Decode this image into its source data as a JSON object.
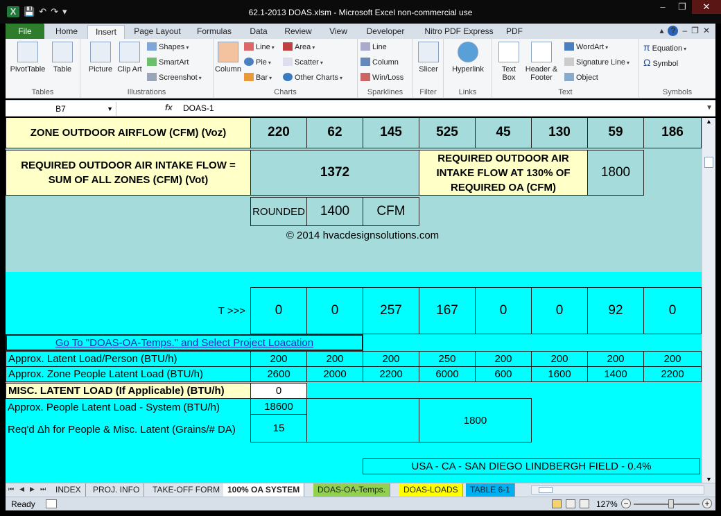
{
  "window": {
    "title": "62.1-2013 DOAS.xlsm  -  Microsoft Excel non-commercial use",
    "app_icon": "X",
    "save_icon": "save-icon",
    "undo_icon": "undo-icon",
    "redo_icon": "redo-icon"
  },
  "ribbon_tabs": [
    {
      "label": "File"
    },
    {
      "label": "Home"
    },
    {
      "label": "Insert"
    },
    {
      "label": "Page Layout"
    },
    {
      "label": "Formulas"
    },
    {
      "label": "Data"
    },
    {
      "label": "Review"
    },
    {
      "label": "View"
    },
    {
      "label": "Developer"
    },
    {
      "label": "Nitro PDF Express"
    },
    {
      "label": "PDF"
    }
  ],
  "active_tab": "Insert",
  "ribbon": {
    "tables": {
      "label": "Tables",
      "pivot": "PivotTable",
      "table": "Table"
    },
    "illustrations": {
      "label": "Illustrations",
      "picture": "Picture",
      "clipart": "Clip Art",
      "shapes": "Shapes",
      "smartart": "SmartArt",
      "screenshot": "Screenshot"
    },
    "charts": {
      "label": "Charts",
      "column": "Column",
      "line": "Line",
      "pie": "Pie",
      "bar": "Bar",
      "area": "Area",
      "scatter": "Scatter",
      "other": "Other Charts"
    },
    "sparklines": {
      "label": "Sparklines",
      "line": "Line",
      "column": "Column",
      "winloss": "Win/Loss"
    },
    "filter": {
      "label": "Filter",
      "slicer": "Slicer"
    },
    "links": {
      "label": "Links",
      "hyperlink": "Hyperlink"
    },
    "text": {
      "label": "Text",
      "textbox": "Text Box",
      "header": "Header & Footer",
      "wordart": "WordArt",
      "signature": "Signature Line",
      "object": "Object"
    },
    "symbols": {
      "label": "Symbols",
      "equation": "Equation",
      "symbol": "Symbol"
    }
  },
  "formula_bar": {
    "name_box": "B7",
    "fx": "fx",
    "formula": "DOAS-1"
  },
  "sheet": {
    "zone_oa_label": "ZONE OUTDOOR AIRFLOW   (CFM)   (Voz)",
    "zone_oa_values": [
      "220",
      "62",
      "145",
      "525",
      "45",
      "130",
      "59",
      "186"
    ],
    "req_oa_label": "REQUIRED OUTDOOR AIR INTAKE FLOW = SUM OF ALL ZONES  (CFM)  (Vot)",
    "req_oa_value": "1372",
    "req_oa130_label": "REQUIRED OUTDOOR AIR INTAKE FLOW AT 130% OF REQUIRED OA  (CFM)",
    "req_oa130_value": "1800",
    "rounded_label": "ROUNDED",
    "rounded_value": "1400",
    "rounded_unit": "CFM",
    "copyright": "© 2014 hvacdesignsolutions.com",
    "t_label": "T >>>",
    "t_values": [
      "0",
      "0",
      "257",
      "167",
      "0",
      "0",
      "92",
      "0"
    ],
    "goto_link": "Go To \"DOAS-OA-Temps.\" and Select Project Loacation",
    "latent_person_label": "Approx. Latent Load/Person (BTU/h)",
    "latent_person_values": [
      "200",
      "200",
      "200",
      "250",
      "200",
      "200",
      "200",
      "200"
    ],
    "zone_people_label": "Approx. Zone People Latent Load (BTU/h)",
    "zone_people_values": [
      "2600",
      "2000",
      "2200",
      "6000",
      "600",
      "1600",
      "1400",
      "2200"
    ],
    "misc_latent_label": "MISC. LATENT LOAD (If Applicable) (BTU/h)",
    "misc_latent_value": "0",
    "people_system_label": "Approx. People Latent Load - System (BTU/h)",
    "people_system_value": "18600",
    "reqd_dh_label": "Req'd Δh for People & Misc. Latent (Grains/# DA)",
    "reqd_dh_value": "15",
    "right_box_value": "1800",
    "location": "USA - CA - SAN DIEGO LINDBERGH FIELD - 0.4%"
  },
  "sheet_tabs": [
    {
      "label": "INDEX"
    },
    {
      "label": "PROJ. INFO"
    },
    {
      "label": "TAKE-OFF FORM"
    },
    {
      "label": "100% OA SYSTEM"
    },
    {
      "label": "DOAS-OA-Temps."
    },
    {
      "label": "DOAS-LOADS"
    },
    {
      "label": "TABLE 6-1"
    }
  ],
  "status": {
    "ready": "Ready",
    "zoom": "127%"
  }
}
